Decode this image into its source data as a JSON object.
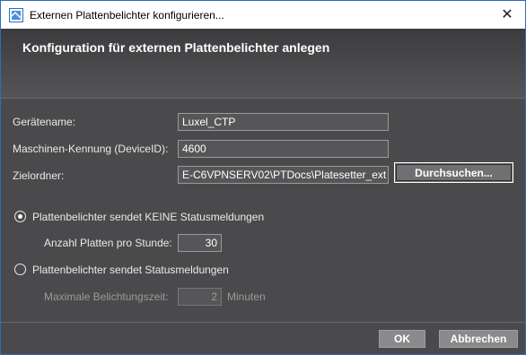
{
  "window": {
    "title": "Externen Plattenbelichter konfigurieren..."
  },
  "header": {
    "title": "Konfiguration für externen Plattenbelichter anlegen"
  },
  "form": {
    "device_name_label": "Gerätename:",
    "device_name_value": "Luxel_CTP",
    "device_id_label": "Maschinen-Kennung (DeviceID):",
    "device_id_value": "4600",
    "target_folder_label": "Zielordner:",
    "target_folder_value": "E-C6VPNSERV02\\PTDocs\\Platesetter_ext",
    "browse_label": "Durchsuchen..."
  },
  "options": {
    "no_status": {
      "label": "Plattenbelichter sendet KEINE Statusmeldungen",
      "selected": true,
      "plates_per_hour_label": "Anzahl Platten pro Stunde:",
      "plates_per_hour_value": "30"
    },
    "with_status": {
      "label": "Plattenbelichter sendet Statusmeldungen",
      "selected": false,
      "max_exposure_label": "Maximale Belichtungszeit:",
      "max_exposure_value": "2",
      "unit_label": "Minuten"
    }
  },
  "footer": {
    "ok_label": "OK",
    "cancel_label": "Abbrechen"
  },
  "colors": {
    "accent": "#2d6db5",
    "background": "#4a4a4c"
  }
}
